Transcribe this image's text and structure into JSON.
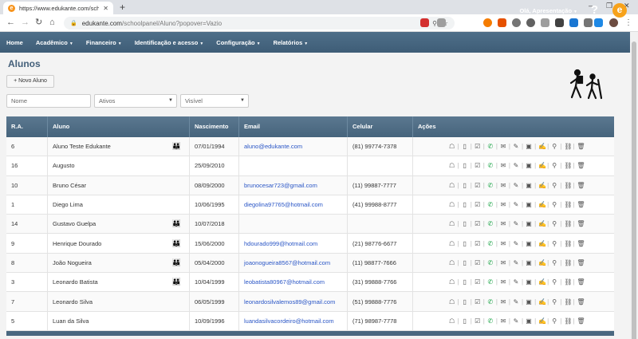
{
  "browser": {
    "tab_title": "https://www.edukante.com/scho",
    "url_domain": "edukante.com",
    "url_path": "/schoolpanel/Aluno?popover=Vazio"
  },
  "nav": {
    "items": [
      {
        "label": "Home",
        "dropdown": false
      },
      {
        "label": "Acadêmico",
        "dropdown": true
      },
      {
        "label": "Financeiro",
        "dropdown": true
      },
      {
        "label": "Identificação e acesso",
        "dropdown": true
      },
      {
        "label": "Configuração",
        "dropdown": true
      },
      {
        "label": "Relatórios",
        "dropdown": true
      }
    ],
    "user": "Olá, Apresentação",
    "help": "?",
    "logo": "e"
  },
  "page": {
    "title": "Alunos",
    "new_button": "+ Novo Aluno",
    "filters": {
      "name_placeholder": "Nome",
      "status": "Ativos",
      "visibility": "Visível"
    }
  },
  "table": {
    "headers": [
      "R.A.",
      "Aluno",
      "Nascimento",
      "Email",
      "Celular",
      "Ações"
    ],
    "rows": [
      {
        "ra": "6",
        "name": "Aluno Teste Edukante",
        "family": true,
        "birth": "07/01/1994",
        "email": "aluno@edukante.com",
        "phone": "(81) 99774-7378"
      },
      {
        "ra": "16",
        "name": "Augusto",
        "family": false,
        "birth": "25/09/2010",
        "email": "",
        "phone": ""
      },
      {
        "ra": "10",
        "name": "Bruno César",
        "family": false,
        "birth": "08/09/2000",
        "email": "brunocesar723@gmail.com",
        "phone": "(11) 99887-7777"
      },
      {
        "ra": "1",
        "name": "Diego Lima",
        "family": false,
        "birth": "10/06/1995",
        "email": "diegolina97765@hotmail.com",
        "phone": "(41) 99988-8777"
      },
      {
        "ra": "14",
        "name": "Gustavo Guelpa",
        "family": true,
        "birth": "10/07/2018",
        "email": "",
        "phone": ""
      },
      {
        "ra": "9",
        "name": "Henrique Dourado",
        "family": true,
        "birth": "15/06/2000",
        "email": "hdourado999@hotmail.com",
        "phone": "(21) 98776-6677"
      },
      {
        "ra": "8",
        "name": "João Nogueira",
        "family": true,
        "birth": "05/04/2000",
        "email": "joaonogueira8567@hotmail.com",
        "phone": "(11) 98877-7666"
      },
      {
        "ra": "3",
        "name": "Leonardo Batista",
        "family": true,
        "birth": "10/04/1999",
        "email": "leobatista80967@hotmail.com",
        "phone": "(31) 99888-7766"
      },
      {
        "ra": "7",
        "name": "Leonardo Silva",
        "family": false,
        "birth": "06/05/1999",
        "email": "leonardosilvalemos89@gmail.com",
        "phone": "(51) 99888-7776"
      },
      {
        "ra": "5",
        "name": "Luan da Silva",
        "family": false,
        "birth": "10/09/1996",
        "email": "luandasilvacordeiro@hotmail.com",
        "phone": "(71) 98987-7778"
      }
    ]
  },
  "colors": {
    "nav": "#46647c",
    "link": "#2a56c6",
    "accent": "#f7a21b"
  }
}
